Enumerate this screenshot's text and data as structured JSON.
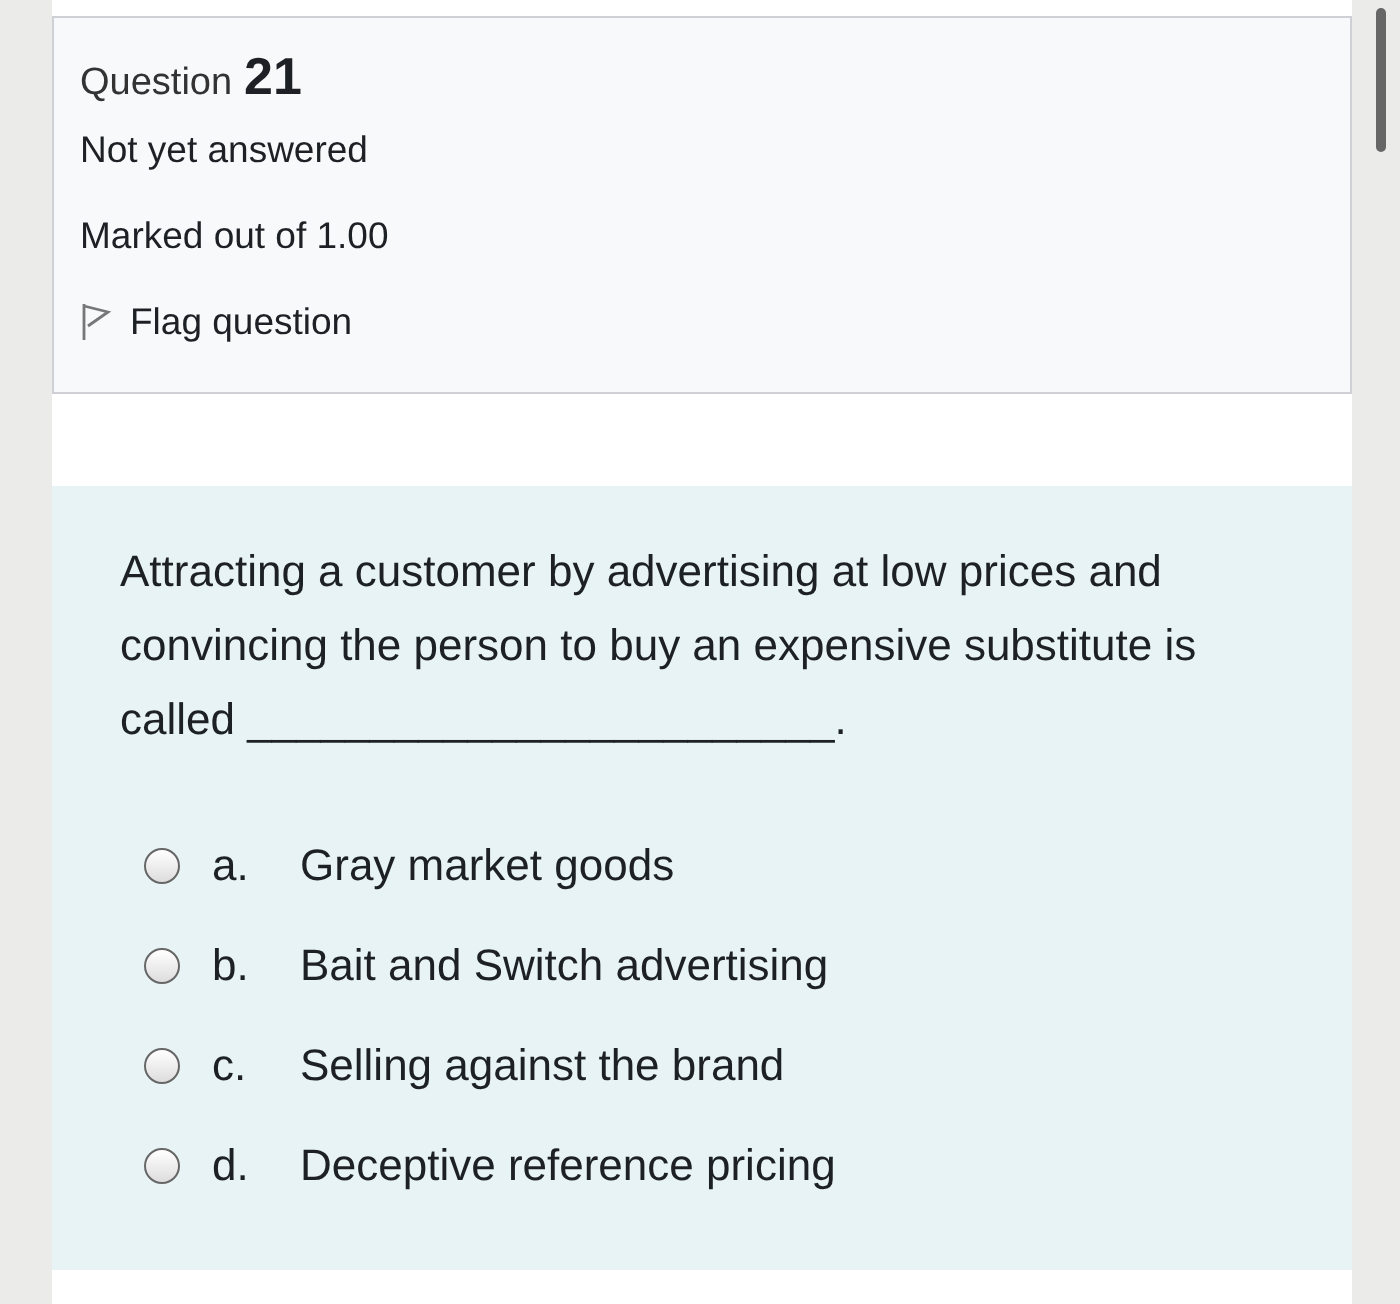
{
  "info": {
    "question_label": "Question",
    "question_number": "21",
    "status": "Not yet answered",
    "marks": "Marked out of 1.00",
    "flag_label": "Flag question",
    "flagged": false
  },
  "question": {
    "text": "Attracting a customer by advertising at low prices and convincing the person to buy an expensive substitute is called ________________________.",
    "options": [
      {
        "letter": "a.",
        "text": "Gray market goods",
        "selected": false
      },
      {
        "letter": "b.",
        "text": "Bait and Switch advertising",
        "selected": false
      },
      {
        "letter": "c.",
        "text": "Selling against the brand",
        "selected": false
      },
      {
        "letter": "d.",
        "text": "Deceptive reference pricing",
        "selected": false
      }
    ]
  }
}
